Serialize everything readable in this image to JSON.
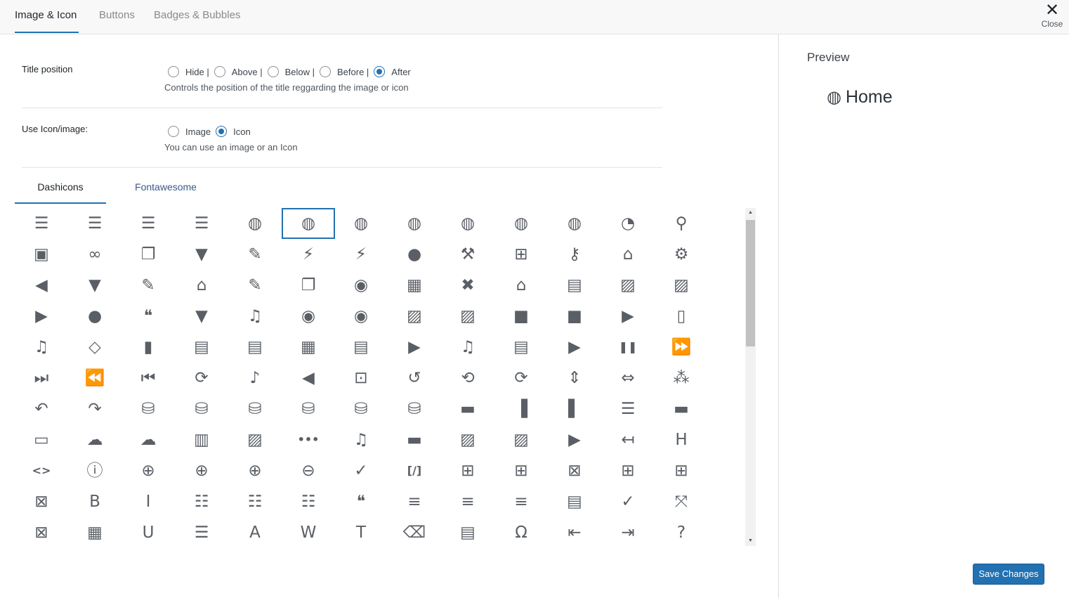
{
  "tabs": [
    "Image & Icon",
    "Buttons",
    "Badges & Bubbles"
  ],
  "close_label": "Close",
  "close_glyph": "✕",
  "title_position": {
    "label": "Title position",
    "options": [
      "Hide |",
      "Above |",
      "Below |",
      "Before |",
      "After"
    ],
    "selected": "After",
    "help": "Controls the position of the title reggarding the image or icon"
  },
  "use_icon": {
    "label": "Use Icon/image:",
    "options": [
      "Image",
      "Icon"
    ],
    "selected": "Icon",
    "help": "You can use an image or an Icon"
  },
  "icon_tabs": [
    "Dashicons",
    "Fontawesome"
  ],
  "active_icon_tab": "Dashicons",
  "colors": {
    "accent": "#2271b1",
    "icon": "#5a5f66"
  },
  "icons": [
    {
      "name": "menu-icon",
      "glyph": "☰"
    },
    {
      "name": "menu-alt-icon",
      "glyph": "☰"
    },
    {
      "name": "menu-alt2-icon",
      "glyph": "☰"
    },
    {
      "name": "menu-alt3-icon",
      "glyph": "☰"
    },
    {
      "name": "admin-site-icon",
      "glyph": "◍"
    },
    {
      "name": "admin-site-alt-icon",
      "glyph": "◍"
    },
    {
      "name": "admin-site-alt2-icon",
      "glyph": "◍"
    },
    {
      "name": "admin-site-alt3-icon",
      "glyph": "◍"
    },
    {
      "name": "globe-icon",
      "glyph": "◍"
    },
    {
      "name": "network-globe-icon",
      "glyph": "◍"
    },
    {
      "name": "globe-alt-icon",
      "glyph": "◍"
    },
    {
      "name": "dashboard-icon",
      "glyph": "◔"
    },
    {
      "name": "pin-icon",
      "glyph": "⚲"
    },
    {
      "name": "admin-media-icon",
      "glyph": "▣"
    },
    {
      "name": "admin-links-icon",
      "glyph": "∞"
    },
    {
      "name": "admin-page-icon",
      "glyph": "❐"
    },
    {
      "name": "admin-comments-icon",
      "glyph": "▼"
    },
    {
      "name": "admin-appearance-icon",
      "glyph": "✎"
    },
    {
      "name": "admin-plugins-icon",
      "glyph": "⚡"
    },
    {
      "name": "plugins-checked-icon",
      "glyph": "⚡"
    },
    {
      "name": "admin-users-icon",
      "glyph": "●"
    },
    {
      "name": "admin-tools-icon",
      "glyph": "⚒"
    },
    {
      "name": "admin-settings-icon",
      "glyph": "⊞"
    },
    {
      "name": "admin-network-icon",
      "glyph": "⚷"
    },
    {
      "name": "admin-home-icon",
      "glyph": "⌂"
    },
    {
      "name": "admin-generic-icon",
      "glyph": "⚙"
    },
    {
      "name": "admin-collapse-icon",
      "glyph": "◀"
    },
    {
      "name": "filter-icon",
      "glyph": "▼"
    },
    {
      "name": "admin-customizer-icon",
      "glyph": "✎"
    },
    {
      "name": "admin-multisite-icon",
      "glyph": "⌂"
    },
    {
      "name": "welcome-write-blog-icon",
      "glyph": "✎"
    },
    {
      "name": "welcome-add-page-icon",
      "glyph": "❐"
    },
    {
      "name": "welcome-view-site-icon",
      "glyph": "◉"
    },
    {
      "name": "welcome-widgets-menus-icon",
      "glyph": "▦"
    },
    {
      "name": "welcome-comments-icon",
      "glyph": "✖"
    },
    {
      "name": "welcome-learn-more-icon",
      "glyph": "⌂"
    },
    {
      "name": "format-aside-icon",
      "glyph": "▤"
    },
    {
      "name": "format-image-icon",
      "glyph": "▨"
    },
    {
      "name": "format-gallery-icon",
      "glyph": "▨"
    },
    {
      "name": "format-video-icon",
      "glyph": "▶"
    },
    {
      "name": "format-status-icon",
      "glyph": "●"
    },
    {
      "name": "format-quote-icon",
      "glyph": "❝"
    },
    {
      "name": "format-chat-icon",
      "glyph": "▼"
    },
    {
      "name": "format-audio-icon",
      "glyph": "♫"
    },
    {
      "name": "camera-icon",
      "glyph": "◉"
    },
    {
      "name": "camera-alt-icon",
      "glyph": "◉"
    },
    {
      "name": "images-alt-icon",
      "glyph": "▨"
    },
    {
      "name": "images-alt2-icon",
      "glyph": "▨"
    },
    {
      "name": "video-alt-icon",
      "glyph": "■"
    },
    {
      "name": "video-alt2-icon",
      "glyph": "■"
    },
    {
      "name": "video-alt3-icon",
      "glyph": "▶"
    },
    {
      "name": "media-archive-icon",
      "glyph": "▯"
    },
    {
      "name": "media-audio-icon",
      "glyph": "♫"
    },
    {
      "name": "media-code-icon",
      "glyph": "◇"
    },
    {
      "name": "media-default-icon",
      "glyph": "▮"
    },
    {
      "name": "media-document-icon",
      "glyph": "▤"
    },
    {
      "name": "media-interactive-icon",
      "glyph": "▤"
    },
    {
      "name": "media-spreadsheet-icon",
      "glyph": "▦"
    },
    {
      "name": "media-text-icon",
      "glyph": "▤"
    },
    {
      "name": "media-video-icon",
      "glyph": "▶"
    },
    {
      "name": "playlist-audio-icon",
      "glyph": "♫"
    },
    {
      "name": "playlist-video-icon",
      "glyph": "▤"
    },
    {
      "name": "controls-play-icon",
      "glyph": "▶"
    },
    {
      "name": "controls-pause-icon",
      "glyph": "❚❚"
    },
    {
      "name": "controls-forward-icon",
      "glyph": "⏩"
    },
    {
      "name": "controls-skipforward-icon",
      "glyph": "⏭"
    },
    {
      "name": "controls-back-icon",
      "glyph": "⏪"
    },
    {
      "name": "controls-skipback-icon",
      "glyph": "⏮"
    },
    {
      "name": "controls-repeat-icon",
      "glyph": "⟳"
    },
    {
      "name": "controls-volumeon-icon",
      "glyph": "♪"
    },
    {
      "name": "controls-volumeoff-icon",
      "glyph": "◀"
    },
    {
      "name": "image-crop-icon",
      "glyph": "⊡"
    },
    {
      "name": "image-rotate-icon",
      "glyph": "↺"
    },
    {
      "name": "image-rotate-left-icon",
      "glyph": "⟲"
    },
    {
      "name": "image-rotate-right-icon",
      "glyph": "⟳"
    },
    {
      "name": "image-flip-vertical-icon",
      "glyph": "⇕"
    },
    {
      "name": "image-flip-horizontal-icon",
      "glyph": "⇔"
    },
    {
      "name": "image-filter-icon",
      "glyph": "⁂"
    },
    {
      "name": "undo-icon",
      "glyph": "↶"
    },
    {
      "name": "redo-icon",
      "glyph": "↷"
    },
    {
      "name": "database-add-icon",
      "glyph": "⛁"
    },
    {
      "name": "database-icon",
      "glyph": "⛁"
    },
    {
      "name": "database-export-icon",
      "glyph": "⛁"
    },
    {
      "name": "database-import-icon",
      "glyph": "⛁"
    },
    {
      "name": "database-remove-icon",
      "glyph": "⛁"
    },
    {
      "name": "database-view-icon",
      "glyph": "⛁"
    },
    {
      "name": "align-full-width-icon",
      "glyph": "▬"
    },
    {
      "name": "align-pull-left-icon",
      "glyph": "▐"
    },
    {
      "name": "align-pull-right-icon",
      "glyph": "▌"
    },
    {
      "name": "align-wide-icon",
      "glyph": "☰"
    },
    {
      "name": "block-default-icon",
      "glyph": "▬"
    },
    {
      "name": "button-icon",
      "glyph": "▭"
    },
    {
      "name": "cloud-saved-icon",
      "glyph": "☁"
    },
    {
      "name": "cloud-upload-icon",
      "glyph": "☁"
    },
    {
      "name": "columns-icon",
      "glyph": "▥"
    },
    {
      "name": "cover-image-icon",
      "glyph": "▨"
    },
    {
      "name": "ellipsis-icon",
      "glyph": "•••"
    },
    {
      "name": "embed-audio-icon",
      "glyph": "♫"
    },
    {
      "name": "embed-generic-icon",
      "glyph": "▬"
    },
    {
      "name": "embed-photo-icon",
      "glyph": "▨"
    },
    {
      "name": "embed-post-icon",
      "glyph": "▨"
    },
    {
      "name": "embed-video-icon",
      "glyph": "▶"
    },
    {
      "name": "exit-icon",
      "glyph": "↤"
    },
    {
      "name": "heading-icon",
      "glyph": "H"
    },
    {
      "name": "html-icon",
      "glyph": "<>"
    },
    {
      "name": "info-outline-icon",
      "glyph": "ⓘ"
    },
    {
      "name": "insert-icon",
      "glyph": "⊕"
    },
    {
      "name": "insert-after-icon",
      "glyph": "⊕"
    },
    {
      "name": "insert-before-icon",
      "glyph": "⊕"
    },
    {
      "name": "remove-icon",
      "glyph": "⊖"
    },
    {
      "name": "saved-icon",
      "glyph": "✓"
    },
    {
      "name": "shortcode-icon",
      "glyph": "[/]"
    },
    {
      "name": "table-col-after-icon",
      "glyph": "⊞"
    },
    {
      "name": "table-col-before-icon",
      "glyph": "⊞"
    },
    {
      "name": "table-col-delete-icon",
      "glyph": "⊠"
    },
    {
      "name": "table-row-after-icon",
      "glyph": "⊞"
    },
    {
      "name": "table-row-before-icon",
      "glyph": "⊞"
    },
    {
      "name": "table-row-delete-icon",
      "glyph": "⊠"
    },
    {
      "name": "editor-bold-icon",
      "glyph": "B"
    },
    {
      "name": "editor-italic-icon",
      "glyph": "I"
    },
    {
      "name": "editor-ul-icon",
      "glyph": "☷"
    },
    {
      "name": "editor-ol-icon",
      "glyph": "☷"
    },
    {
      "name": "editor-ol-rtl-icon",
      "glyph": "☷"
    },
    {
      "name": "editor-quote-icon",
      "glyph": "❝"
    },
    {
      "name": "editor-alignleft-icon",
      "glyph": "≡"
    },
    {
      "name": "editor-aligncenter-icon",
      "glyph": "≡"
    },
    {
      "name": "editor-alignright-icon",
      "glyph": "≡"
    },
    {
      "name": "editor-insertmore-icon",
      "glyph": "▤"
    },
    {
      "name": "editor-spellcheck-icon",
      "glyph": "✓"
    },
    {
      "name": "editor-expand-icon",
      "glyph": "⤧"
    },
    {
      "name": "editor-contract-icon",
      "glyph": "⊠"
    },
    {
      "name": "editor-kitchensink-icon",
      "glyph": "▦"
    },
    {
      "name": "editor-underline-icon",
      "glyph": "U"
    },
    {
      "name": "editor-justify-icon",
      "glyph": "☰"
    },
    {
      "name": "editor-textcolor-icon",
      "glyph": "A"
    },
    {
      "name": "editor-paste-word-icon",
      "glyph": "W"
    },
    {
      "name": "editor-paste-text-icon",
      "glyph": "T"
    },
    {
      "name": "editor-removeformatting-icon",
      "glyph": "⌫"
    },
    {
      "name": "editor-video-icon",
      "glyph": "▤"
    },
    {
      "name": "editor-customchar-icon",
      "glyph": "Ω"
    },
    {
      "name": "editor-outdent-icon",
      "glyph": "⇤"
    },
    {
      "name": "editor-indent-icon",
      "glyph": "⇥"
    },
    {
      "name": "editor-help-icon",
      "glyph": "?"
    }
  ],
  "selected_icon": "admin-site-alt-icon",
  "preview": {
    "title": "Preview",
    "icon_glyph": "◍",
    "text": "Home"
  },
  "save_label": "Save Changes"
}
